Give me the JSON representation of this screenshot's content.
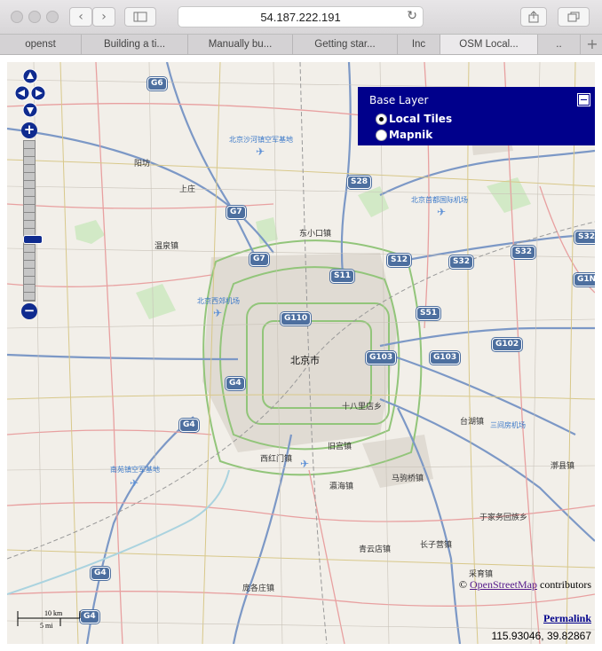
{
  "browser": {
    "address": "54.187.222.191",
    "tabs": [
      "openst",
      "Building a ti...",
      "Manually bu...",
      "Getting star...",
      "Inc",
      "OSM Local...",
      ".."
    ],
    "active_tab": 5
  },
  "map": {
    "layer_switcher": {
      "title": "Base Layer",
      "layers": [
        {
          "label": "Local Tiles",
          "selected": true
        },
        {
          "label": "Mapnik",
          "selected": false
        }
      ]
    },
    "zoom_in_label": "+",
    "zoom_out_label": "−",
    "places": {
      "beijing": "北京市",
      "dongxiaokou": "东小口镇",
      "shibalidian": "十八里店乡",
      "taihu": "台湖镇",
      "jiugong": "旧宫镇",
      "xihongmen": "西红门镇",
      "yinghai": "瀛海镇",
      "majuqiao": "马驹桥镇",
      "yujiawu": "于家务回族乡",
      "lixian": "漷县镇",
      "changziying": "长子营镇",
      "qingyundian": "青云店镇",
      "caiyu": "采育镇",
      "pangezhuang": "庞各庄镇",
      "shangzhuang": "上庄",
      "wenquan": "温泉镇",
      "yangfang": "阳坊"
    },
    "airports": {
      "shahe": "北京沙河镇空军基地",
      "capital": "北京首都国际机场",
      "xijiao": "北京西郊机场",
      "nanyuan": "南苑镇空军基地",
      "sanjianfang": "三间房机场"
    },
    "shields": [
      "G6",
      "S28",
      "G7",
      "G7",
      "S12",
      "S32",
      "S32",
      "S32",
      "G1N",
      "S11",
      "S51",
      "G110",
      "G102",
      "G103",
      "G103",
      "G4",
      "G4",
      "G4",
      "G4"
    ],
    "attribution": {
      "prefix": "©",
      "link": "OpenStreetMap",
      "suffix": "contributors"
    },
    "permalink": "Permalink",
    "coordinates": "115.93046, 39.82867",
    "scale": {
      "km": "10 km",
      "mi": "5 mi"
    }
  }
}
